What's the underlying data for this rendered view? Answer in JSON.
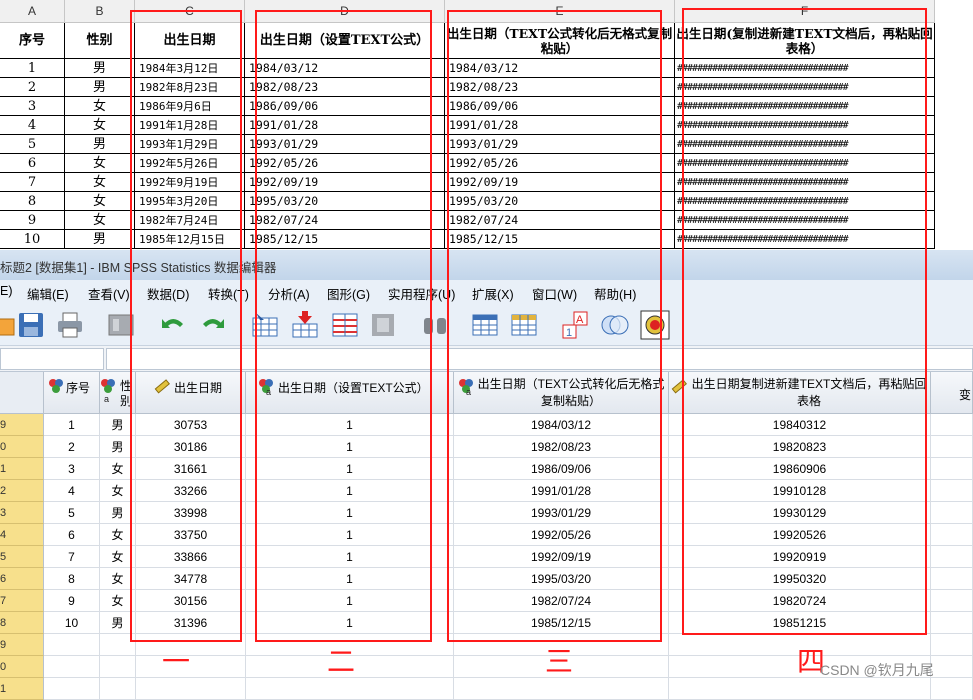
{
  "excel": {
    "col_letters": [
      "A",
      "B",
      "C",
      "D",
      "E",
      "F"
    ],
    "headers": [
      "序号",
      "性别",
      "出生日期",
      "出生日期（设置TEXT公式）",
      "出生日期（TEXT公式转化后无格式复制粘贴）",
      "出生日期(复制进新建TEXT文档后，再粘贴回表格）"
    ],
    "rows": [
      {
        "no": "1",
        "sex": "男",
        "birth": "1984年3月12日",
        "d": "1984/03/12",
        "e": "1984/03/12"
      },
      {
        "no": "2",
        "sex": "男",
        "birth": "1982年8月23日",
        "d": "1982/08/23",
        "e": "1982/08/23"
      },
      {
        "no": "3",
        "sex": "女",
        "birth": "1986年9月6日",
        "d": "1986/09/06",
        "e": "1986/09/06"
      },
      {
        "no": "4",
        "sex": "女",
        "birth": "1991年1月28日",
        "d": "1991/01/28",
        "e": "1991/01/28"
      },
      {
        "no": "5",
        "sex": "男",
        "birth": "1993年1月29日",
        "d": "1993/01/29",
        "e": "1993/01/29"
      },
      {
        "no": "6",
        "sex": "女",
        "birth": "1992年5月26日",
        "d": "1992/05/26",
        "e": "1992/05/26"
      },
      {
        "no": "7",
        "sex": "女",
        "birth": "1992年9月19日",
        "d": "1992/09/19",
        "e": "1992/09/19"
      },
      {
        "no": "8",
        "sex": "女",
        "birth": "1995年3月20日",
        "d": "1995/03/20",
        "e": "1995/03/20"
      },
      {
        "no": "9",
        "sex": "女",
        "birth": "1982年7月24日",
        "d": "1982/07/24",
        "e": "1982/07/24"
      },
      {
        "no": "10",
        "sex": "男",
        "birth": "1985年12月15日",
        "d": "1985/12/15",
        "e": "1985/12/15"
      }
    ],
    "hash_text": "##################################"
  },
  "spss": {
    "title": "标题2 [数据集1] - IBM SPSS Statistics 数据编辑器",
    "menu": [
      "E)",
      "编辑(E)",
      "查看(V)",
      "数据(D)",
      "转换(T)",
      "分析(A)",
      "图形(G)",
      "实用程序(U)",
      "扩展(X)",
      "窗口(W)",
      "帮助(H)"
    ],
    "headers": [
      "序号",
      "性别",
      "出生日期",
      "出生日期（设置TEXT公式）",
      "出生日期（TEXT公式转化后无格式复制粘贴）",
      "出生日期复制进新建TEXT文档后，再粘贴回表格",
      "变"
    ],
    "row_labels": [
      "9",
      "0",
      "1",
      "2",
      "3",
      "4",
      "5",
      "6",
      "7",
      "8",
      "9",
      "0",
      "1"
    ],
    "rows": [
      {
        "no": "1",
        "sex": "男",
        "birth": "30753",
        "d": "1",
        "e": "1984/03/12",
        "f": "19840312"
      },
      {
        "no": "2",
        "sex": "男",
        "birth": "30186",
        "d": "1",
        "e": "1982/08/23",
        "f": "19820823"
      },
      {
        "no": "3",
        "sex": "女",
        "birth": "31661",
        "d": "1",
        "e": "1986/09/06",
        "f": "19860906"
      },
      {
        "no": "4",
        "sex": "女",
        "birth": "33266",
        "d": "1",
        "e": "1991/01/28",
        "f": "19910128"
      },
      {
        "no": "5",
        "sex": "男",
        "birth": "33998",
        "d": "1",
        "e": "1993/01/29",
        "f": "19930129"
      },
      {
        "no": "6",
        "sex": "女",
        "birth": "33750",
        "d": "1",
        "e": "1992/05/26",
        "f": "19920526"
      },
      {
        "no": "7",
        "sex": "女",
        "birth": "33866",
        "d": "1",
        "e": "1992/09/19",
        "f": "19920919"
      },
      {
        "no": "8",
        "sex": "女",
        "birth": "34778",
        "d": "1",
        "e": "1995/03/20",
        "f": "19950320"
      },
      {
        "no": "9",
        "sex": "女",
        "birth": "30156",
        "d": "1",
        "e": "1982/07/24",
        "f": "19820724"
      },
      {
        "no": "10",
        "sex": "男",
        "birth": "31396",
        "d": "1",
        "e": "1985/12/15",
        "f": "19851215"
      }
    ]
  },
  "annotations": {
    "marks": [
      "一",
      "二",
      "三",
      "四"
    ],
    "watermark": "CSDN @钦月九尾"
  },
  "colors": {
    "annotation_red": "#ff1a1a",
    "row_header": "#f7e08c"
  }
}
